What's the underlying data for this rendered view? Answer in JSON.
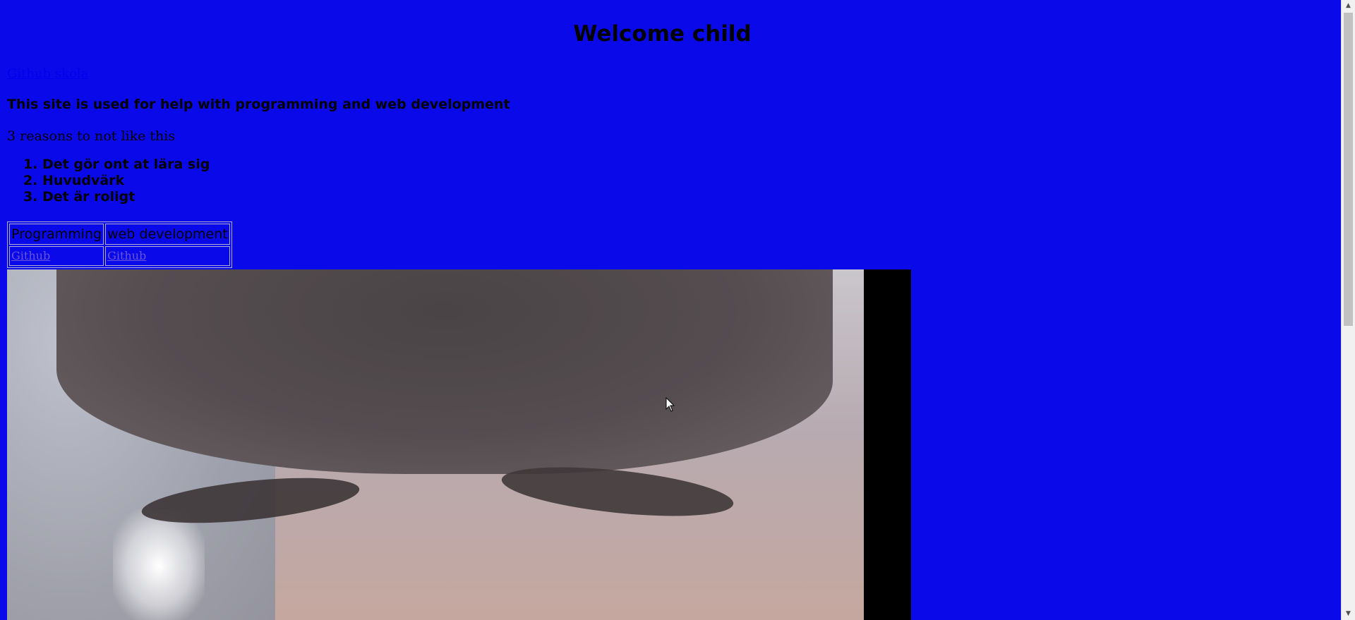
{
  "page": {
    "title": "Welcome child",
    "top_link": "Github skola",
    "subtitle": "This site is used for help with programming and web development",
    "reasons_heading": "3 reasons to not like this",
    "reasons": [
      "Det gör ont at lära sig",
      "Huvudvärk",
      "Det är roligt"
    ]
  },
  "table": {
    "headers": [
      "Programming",
      "web development"
    ],
    "links": [
      "Github",
      "Github"
    ]
  },
  "scrollbar": {
    "up_arrow": "▲",
    "down_arrow": "▼"
  },
  "colors": {
    "background": "#0909ea",
    "link": "#0000ee",
    "visited_link": "#6a56d8"
  }
}
